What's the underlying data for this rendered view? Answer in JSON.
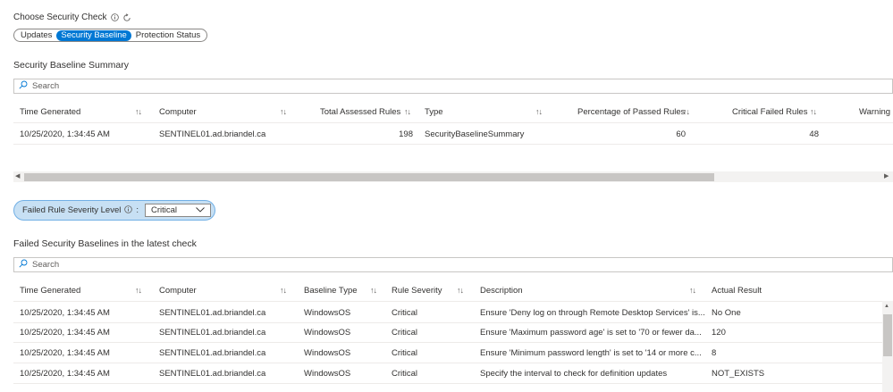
{
  "header": {
    "choose_label": "Choose Security Check",
    "tabs": [
      "Updates",
      "Security Baseline",
      "Protection Status"
    ],
    "active_tab": "Security Baseline"
  },
  "summary": {
    "title": "Security Baseline Summary",
    "search_placeholder": "Search",
    "columns": [
      "Time Generated",
      "Computer",
      "Total Assessed Rules",
      "Type",
      "Percentage of Passed Rules",
      "Critical Failed Rules",
      "Warning Fai"
    ],
    "rows": [
      [
        "10/25/2020, 1:34:45 AM",
        "SENTINEL01.ad.briandel.ca",
        "198",
        "SecurityBaselineSummary",
        "60",
        "48",
        ""
      ]
    ]
  },
  "filter": {
    "label": "Failed Rule Severity Level",
    "separator": ":",
    "selected": "Critical"
  },
  "failed": {
    "title": "Failed Security Baselines in the latest check",
    "search_placeholder": "Search",
    "columns": [
      "Time Generated",
      "Computer",
      "Baseline Type",
      "Rule Severity",
      "Description",
      "Actual Result"
    ],
    "rows": [
      [
        "10/25/2020, 1:34:45 AM",
        "SENTINEL01.ad.briandel.ca",
        "WindowsOS",
        "Critical",
        "Ensure 'Deny log on through Remote Desktop Services' is...",
        "No One"
      ],
      [
        "10/25/2020, 1:34:45 AM",
        "SENTINEL01.ad.briandel.ca",
        "WindowsOS",
        "Critical",
        "Ensure 'Maximum password age' is set to '70 or fewer da...",
        "120"
      ],
      [
        "10/25/2020, 1:34:45 AM",
        "SENTINEL01.ad.briandel.ca",
        "WindowsOS",
        "Critical",
        "Ensure 'Minimum password length' is set to '14 or more c...",
        "8"
      ],
      [
        "10/25/2020, 1:34:45 AM",
        "SENTINEL01.ad.briandel.ca",
        "WindowsOS",
        "Critical",
        "Specify the interval to check for definition updates",
        "NOT_EXISTS"
      ]
    ]
  },
  "icons": {
    "info": "info-icon",
    "refresh": "refresh-icon",
    "search": "search-icon",
    "chevron": "chevron-down-icon",
    "sort": "sort-icon"
  },
  "colors": {
    "accent": "#0078d4",
    "filter_bg": "#c7e0f4",
    "filter_border": "#71afe5"
  }
}
